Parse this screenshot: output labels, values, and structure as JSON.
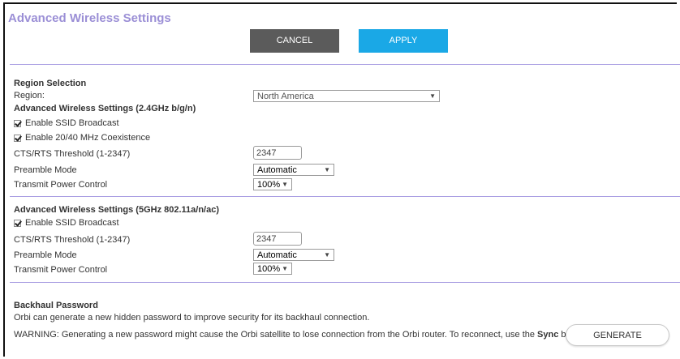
{
  "page": {
    "title": "Advanced Wireless Settings"
  },
  "toolbar": {
    "cancel_label": "CANCEL",
    "apply_label": "APPLY"
  },
  "colors": {
    "title": "#9b8fd6",
    "cancel_bg": "#5b5b5b",
    "apply_bg": "#1aa8e6",
    "divider": "#a99ee2"
  },
  "region": {
    "heading": "Region Selection",
    "label": "Region:",
    "value": "North America"
  },
  "band24": {
    "heading": "Advanced Wireless Settings (2.4GHz b/g/n)",
    "ssid_broadcast": "Enable SSID Broadcast",
    "coexistence": "Enable 20/40 MHz Coexistence",
    "cts_label": "CTS/RTS Threshold (1-2347)",
    "cts_value": "2347",
    "preamble_label": "Preamble Mode",
    "preamble_value": "Automatic",
    "power_label": "Transmit Power Control",
    "power_value": "100%"
  },
  "band5": {
    "heading": "Advanced Wireless Settings (5GHz 802.11a/n/ac)",
    "ssid_broadcast": "Enable SSID Broadcast",
    "cts_label": "CTS/RTS Threshold (1-2347)",
    "cts_value": "2347",
    "preamble_label": "Preamble Mode",
    "preamble_value": "Automatic",
    "power_label": "Transmit Power Control",
    "power_value": "100%"
  },
  "backhaul": {
    "heading": "Backhaul Password",
    "description": "Orbi can generate a new hidden password to improve security for its backhaul connection.",
    "warning_prefix": "WARNING: Generating a new password might cause the Orbi satellite to lose connection from the Orbi router. To reconnect, use the ",
    "warning_bold": "Sync",
    "warning_suffix": " button.",
    "generate_label": "GENERATE"
  }
}
